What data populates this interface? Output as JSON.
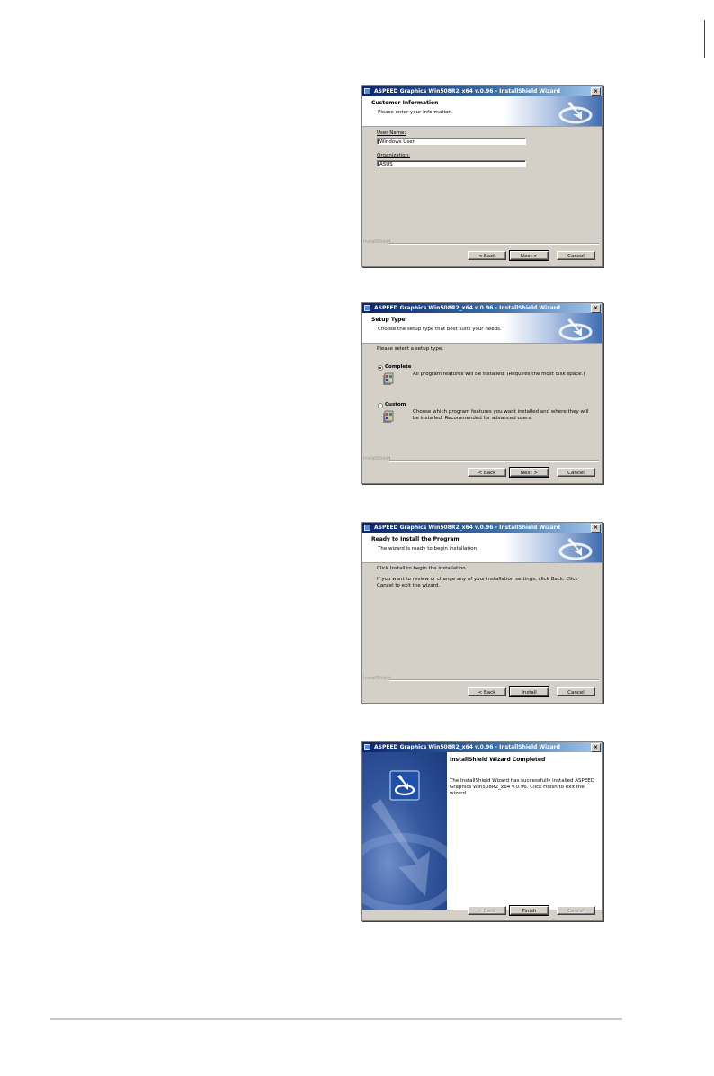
{
  "dialogs": {
    "window_title": "ASPEED Graphics Win508R2_x64 v.0.96 - InstallShield Wizard",
    "brand": "InstallShield",
    "customer": {
      "title": "Customer Information",
      "subtitle": "Please enter your information.",
      "user_label": "User Name:",
      "user_value": "Windows User",
      "org_label": "Organization:",
      "org_value": "ASUS",
      "back": "< Back",
      "next": "Next >",
      "cancel": "Cancel"
    },
    "setup": {
      "title": "Setup Type",
      "subtitle": "Choose the setup type that best suits your needs.",
      "prompt": "Please select a setup type.",
      "complete_label": "Complete",
      "complete_desc": "All program features will be installed. (Requires the most disk space.)",
      "custom_label": "Custom",
      "custom_desc": "Choose which program features you want installed and where they will be installed. Recommended for advanced users.",
      "back": "< Back",
      "next": "Next >",
      "cancel": "Cancel"
    },
    "ready": {
      "title": "Ready to Install the Program",
      "subtitle": "The wizard is ready to begin installation.",
      "line1": "Click Install to begin the installation.",
      "line2": "If you want to review or change any of your installation settings, click Back. Click Cancel to exit the wizard.",
      "back": "< Back",
      "install": "Install",
      "cancel": "Cancel"
    },
    "finish": {
      "title": "InstallShield Wizard Completed",
      "message": "The InstallShield Wizard has successfully installed ASPEED Graphics Win508R2_x64 v.0.96. Click Finish to exit the wizard.",
      "back": "< Back",
      "finish": "Finish",
      "cancel": "Cancel"
    }
  },
  "colors": {
    "title_bar": "#0b246a",
    "dialog_face": "#d4d0c8",
    "accent_blue": "#3f6bb0"
  }
}
